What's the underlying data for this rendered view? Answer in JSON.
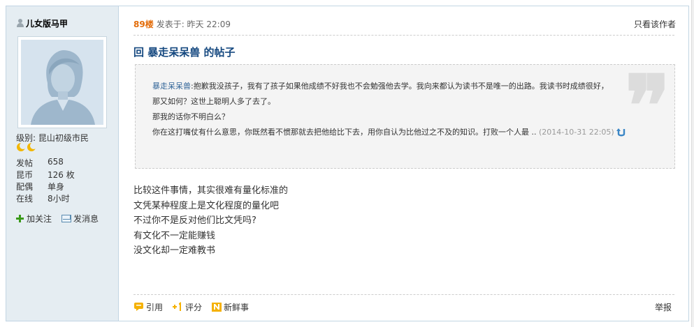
{
  "author": {
    "name": "儿女版马甲",
    "level_label": "级别:",
    "level_value": "昆山初级市民",
    "stats": [
      {
        "key": "发帖",
        "value": "658"
      },
      {
        "key": "昆币",
        "value": "126 枚"
      },
      {
        "key": "配偶",
        "value": "单身"
      },
      {
        "key": "在线",
        "value": "8小时"
      }
    ],
    "follow_label": "加关注",
    "message_label": "发消息"
  },
  "post": {
    "floor": "89楼",
    "posted_at": "发表于: 昨天 22:09",
    "author_only": "只看该作者",
    "title": "回 暴走呆呆兽 的帖子",
    "quote": {
      "user": "暴走呆呆兽",
      "line1": ":抱歉我没孩子，我有了孩子如果他成绩不好我也不会勉强他去学。我向来都认为读书不是唯一的出路。我读书时成绩很好，",
      "line2": "那又如何？这世上聪明人多了去了。",
      "line3": "那我的话你不明白么？",
      "line4": "你在这打嘴仗有什么意思，你既然看不惯那就去把他给比下去，用你自认为比他过之不及的知识。打败一个人最 ..",
      "date": " (2014-10-31 22:05)"
    },
    "content": [
      "比较这件事情，其实很难有量化标准的",
      "文凭某种程度上是文化程度的量化吧",
      "不过你不是反对他们比文凭吗?",
      "有文化不一定能赚钱",
      "没文化却一定难教书"
    ],
    "footer": {
      "quote_label": "引用",
      "rate_label": "评分",
      "news_label": "新鲜事",
      "report_label": "举报"
    }
  },
  "colors": {
    "sidebar_bg": "#e5edf2",
    "border": "#c2d5e3",
    "floor": "#e36c09",
    "title": "#164980",
    "link": "#336699"
  },
  "icons": [
    "user-icon",
    "avatar-silhouette",
    "moon-icon",
    "plus-icon",
    "message-icon",
    "quote-mark-icon",
    "jump-back-icon",
    "quote-reply-icon",
    "rate-icon",
    "news-icon"
  ]
}
